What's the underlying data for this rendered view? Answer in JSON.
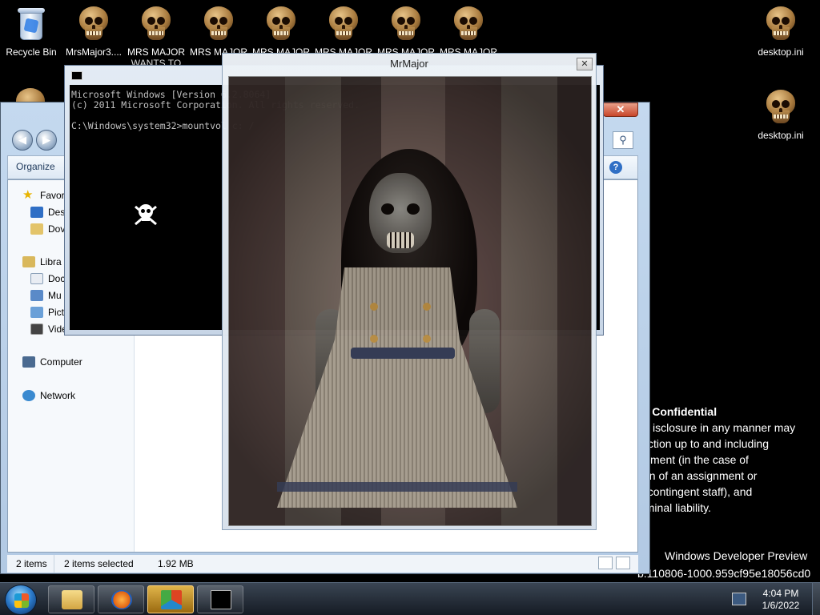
{
  "desktop": {
    "icons": [
      {
        "label": "Recycle Bin"
      },
      {
        "label": "MrsMajor3...."
      },
      {
        "label": "MRS MAJOR"
      },
      {
        "label": "MRS MAJOR"
      },
      {
        "label": "MRS MAJOR"
      },
      {
        "label": "MRS MAJOR"
      },
      {
        "label": "MRS MAJOR"
      },
      {
        "label": "MRS MAJOR"
      },
      {
        "label": "desktop.ini"
      },
      {
        "label": "desktop.ini"
      }
    ],
    "icon_sublabel": "WANTS TO"
  },
  "explorer": {
    "organize_label": "Organize",
    "nav": {
      "favorites": "Favor",
      "desktop": "Des",
      "downloads": "Dov",
      "libraries": "Libra",
      "documents": "Doc",
      "music": "Mu",
      "pictures": "Pict",
      "videos": "Vide",
      "computer": "Computer",
      "network": "Network"
    },
    "status": {
      "items": "2 items",
      "selected": "2 items selected",
      "size": "1.92 MB"
    }
  },
  "cmd": {
    "line1": "Microsoft Windows [Version 6.2.8064]",
    "line2": "(c) 2011 Microsoft Corporation. All rights reserved.",
    "prompt": "C:\\Windows\\system32>mountvol c: /"
  },
  "mrmajor": {
    "title": "MrMajor"
  },
  "confidential": {
    "heading": "ft Confidential",
    "lines": [
      "isclosure in any manner may",
      "ction up to and including",
      "yment (in the case of",
      "on of an assignment or",
      "f contingent staff), and",
      "riminal liability."
    ]
  },
  "watermark": {
    "line1": "Windows Developer Preview",
    "line2": "b.110806-1000.959cf95e18056cd0"
  },
  "taskbar": {
    "time": "4:04 PM",
    "date": "1/6/2022"
  }
}
